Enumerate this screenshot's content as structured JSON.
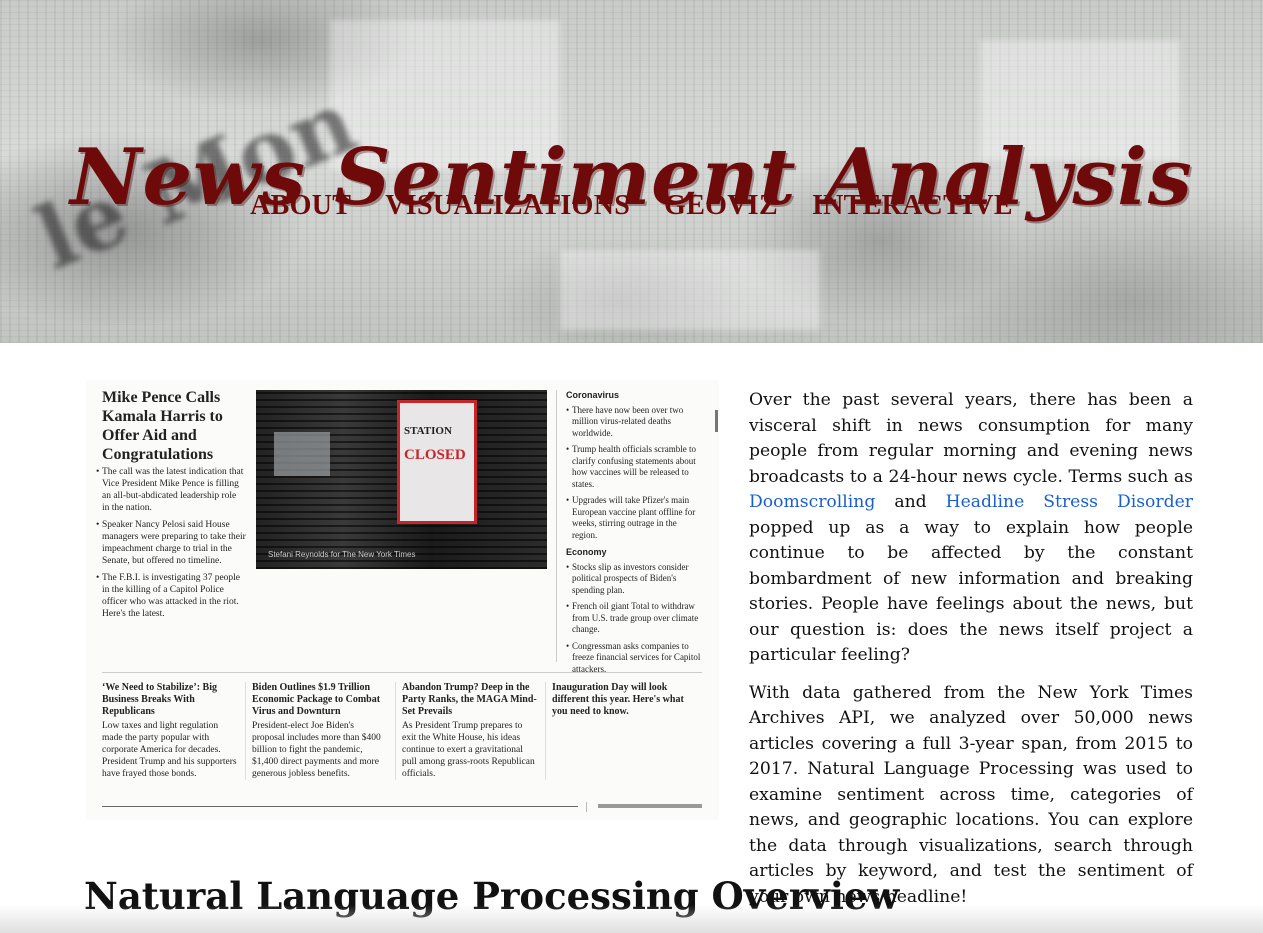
{
  "header": {
    "title": "News Sentiment Analysis",
    "nav": [
      "ABOUT",
      "VISUALIZATIONS",
      "GEOVIZ",
      "INTERACTIVE"
    ]
  },
  "newspaper": {
    "lead": {
      "headline": "Mike Pence Calls Kamala Harris to Offer Aid and Congratulations",
      "bullets": [
        "The call was the latest indication that Vice President Mike Pence is filling an all-but-abdicated leadership role in the nation.",
        "Speaker Nancy Pelosi said House managers were preparing to take their impeachment charge to trial in the Senate, but offered no timeline.",
        "The F.B.I. is investigating 37 people in the killing of a Capitol Police officer who was attacked in the riot. Here's the latest."
      ]
    },
    "photo": {
      "sign_line1": "STATION",
      "sign_line2": "CLOSED",
      "caption": "Stefani Reynolds for The New York Times"
    },
    "sidebar": {
      "section1": "Coronavirus",
      "items1": [
        "There have now been over two million virus-related deaths worldwide.",
        "Trump health officials scramble to clarify confusing statements about how vaccines will be released to states.",
        "Upgrades will take Pfizer's main European vaccine plant offline for weeks, stirring outrage in the region."
      ],
      "section2": "Economy",
      "items2": [
        "Stocks slip as investors consider political prospects of Biden's spending plan.",
        "French oil giant Total to withdraw from U.S. trade group over climate change.",
        "Congressman asks companies to freeze financial services for Capitol attackers."
      ]
    },
    "bottom": [
      {
        "headline": "‘We Need to Stabilize’: Big Business Breaks With Republicans",
        "text": "Low taxes and light regulation made the party popular with corporate America for decades. President Trump and his supporters have frayed those bonds."
      },
      {
        "headline": "Biden Outlines $1.9 Trillion Economic Package to Combat Virus and Downturn",
        "text": "President-elect Joe Biden's proposal includes more than $400 billion to fight the pandemic, $1,400 direct payments and more generous jobless benefits."
      },
      {
        "headline": "Abandon Trump? Deep in the Party Ranks, the MAGA Mind-Set Prevails",
        "text": "As President Trump prepares to exit the White House, his ideas continue to exert a gravitational pull among grass-roots Republican officials."
      },
      {
        "headline": "Inauguration Day will look different this year. Here's what you need to know.",
        "text": ""
      }
    ]
  },
  "intro": {
    "p1_a": "Over the past several years, there has been a visceral shift in news consumption for many people from regular morning and evening news broadcasts to a 24-hour news cycle. Terms such as ",
    "link1": "Doomscrolling",
    "p1_b": " and ",
    "link2": "Headline Stress Disorder",
    "p1_c": " popped up as a way to explain how people continue to be affected by the constant bombardment of new information and breaking stories. People have feelings about the news, but our question is: does the news itself project a particular feeling?",
    "p2": "With data gathered from the New York Times Archives API, we analyzed over 50,000 news articles covering a full 3-year span, from 2015 to 2017. Natural Language Processing was used to examine sentiment across time, categories of news, and geographic locations. You can explore the data through visualizations, search through articles by keyword, and test the sentiment of your own news headline!"
  },
  "section": {
    "title": "Natural Language Processing Overview"
  },
  "colors": {
    "title": "#6e0a0a",
    "link": "#1a5fd0"
  }
}
